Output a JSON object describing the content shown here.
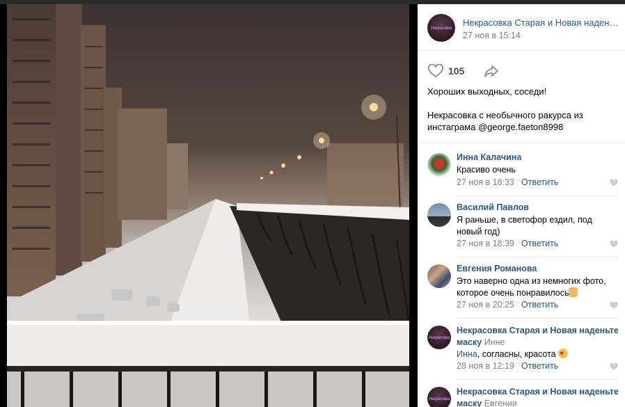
{
  "post": {
    "group_name": "Некрасовка Старая и Новая наден…",
    "date": "27 ноя в 15:14",
    "avatar_label": "Некрасовка",
    "likes": "105",
    "text_line1": "Хороших выходных, соседи!",
    "text_line2": "Некрасовка с необычного ракурса из инстаграма @george.faeton8998"
  },
  "icons": {
    "like": "heart-outline-icon",
    "share": "share-arrow-icon"
  },
  "colors": {
    "link": "#2a5885",
    "muted": "#828282",
    "divider": "#e7e8ec"
  },
  "comments": [
    {
      "author": "Инна Калачина",
      "text": "Красиво очень",
      "date": "27 ноя в 18:33",
      "reply": "Ответить"
    },
    {
      "author": "Василий Павлов",
      "text": "Я раньше, в светофор ездил, под новый год)",
      "date": "27 ноя в 18:39",
      "reply": "Ответить"
    },
    {
      "author": "Евгения Романова",
      "text": "Это наверно одна из немногих фото, которое очень понравилось",
      "date": "27 ноя в 20:25",
      "reply": "Ответить"
    },
    {
      "author": "Некрасовка Старая и Новая наденьте маску",
      "reply_to_name": "Инне",
      "mention": "Инна",
      "text": ", согласны, красота",
      "date": "28 ноя в 12:19",
      "reply": "Ответить"
    },
    {
      "author": "Некрасовка Старая и Новая наденьте маску",
      "reply_to_name": "Евгении"
    }
  ]
}
